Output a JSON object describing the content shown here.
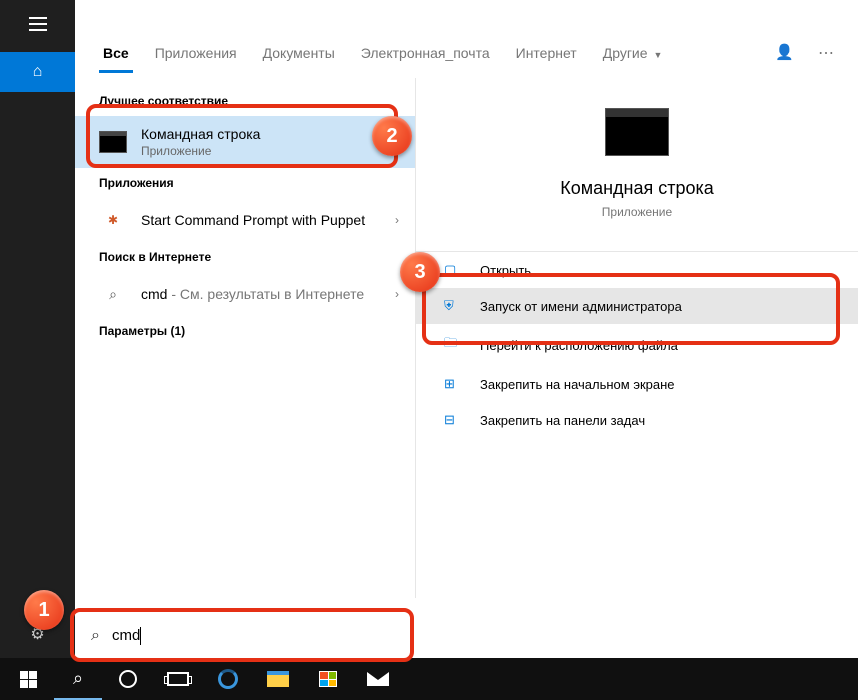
{
  "tabs": {
    "items": [
      "Все",
      "Приложения",
      "Документы",
      "Электронная_почта",
      "Интернет",
      "Другие"
    ],
    "active_index": 0
  },
  "sections": {
    "best_match": "Лучшее соответствие",
    "apps": "Приложения",
    "web": "Поиск в Интернете",
    "settings": "Параметры (1)"
  },
  "results": {
    "best": {
      "title": "Командная строка",
      "sub": "Приложение"
    },
    "app1": {
      "title": "Start Command Prompt with Puppet"
    },
    "web1": {
      "prefix": "cmd",
      "suffix": " - См. результаты в Интернете"
    }
  },
  "preview": {
    "title": "Командная строка",
    "sub": "Приложение",
    "actions": [
      "Открыть",
      "Запуск от имени администратора",
      "Перейти к расположению файла",
      "Закрепить на начальном экране",
      "Закрепить на панели задач"
    ]
  },
  "search": {
    "value": "cmd"
  },
  "badges": {
    "b1": "1",
    "b2": "2",
    "b3": "3"
  }
}
